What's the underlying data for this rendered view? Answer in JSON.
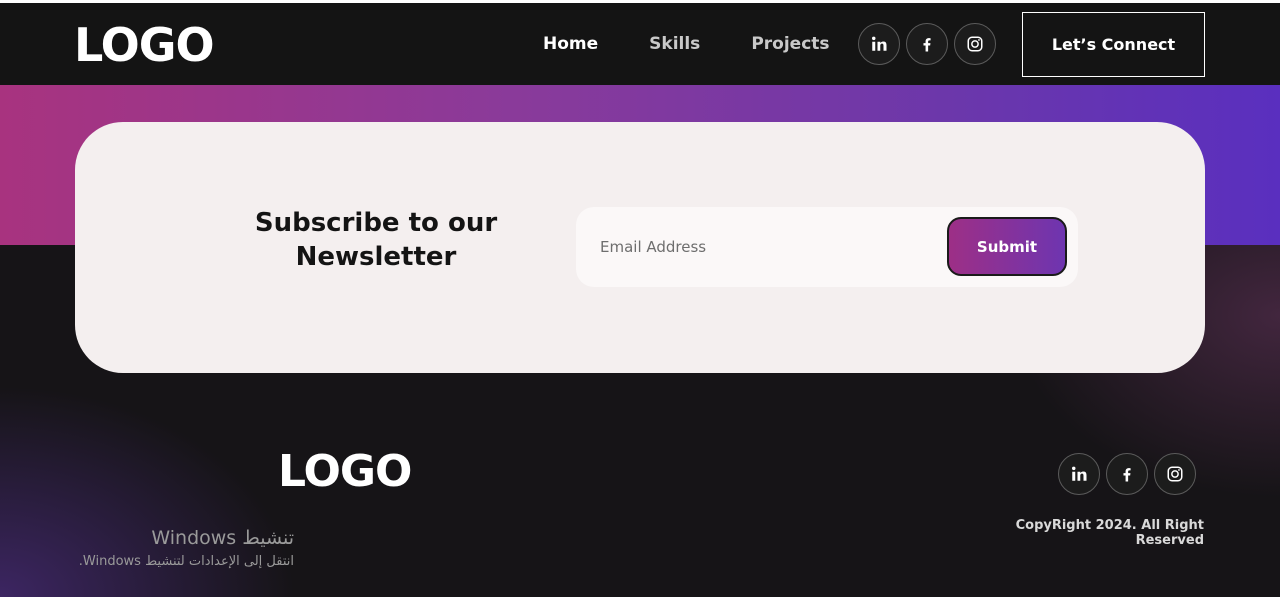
{
  "header": {
    "logo": "LOGO",
    "nav": [
      {
        "label": "Home"
      },
      {
        "label": "Skills"
      },
      {
        "label": "Projects"
      }
    ],
    "social": [
      {
        "icon": "linkedin-icon",
        "text": "in"
      },
      {
        "icon": "facebook-icon",
        "text": "f"
      },
      {
        "icon": "instagram-icon"
      }
    ],
    "cta_label": "Let’s Connect"
  },
  "newsletter": {
    "title_line1": "Subscribe to our",
    "title_line2": "Newsletter",
    "email_placeholder": "Email Address",
    "submit_label": "Submit"
  },
  "footer": {
    "logo": "LOGO",
    "social": [
      {
        "icon": "linkedin-icon",
        "text": "in"
      },
      {
        "icon": "facebook-icon",
        "text": "f"
      },
      {
        "icon": "instagram-icon"
      }
    ],
    "copyright": "CopyRight 2024. All Right Reserved"
  },
  "windows_activation": {
    "title": "تنشيط Windows",
    "subtitle": "انتقل إلى الإعدادات لتنشيط Windows."
  },
  "colors": {
    "accent_start": "#a8337f",
    "accent_end": "#5a2fbf",
    "background": "#141414"
  }
}
